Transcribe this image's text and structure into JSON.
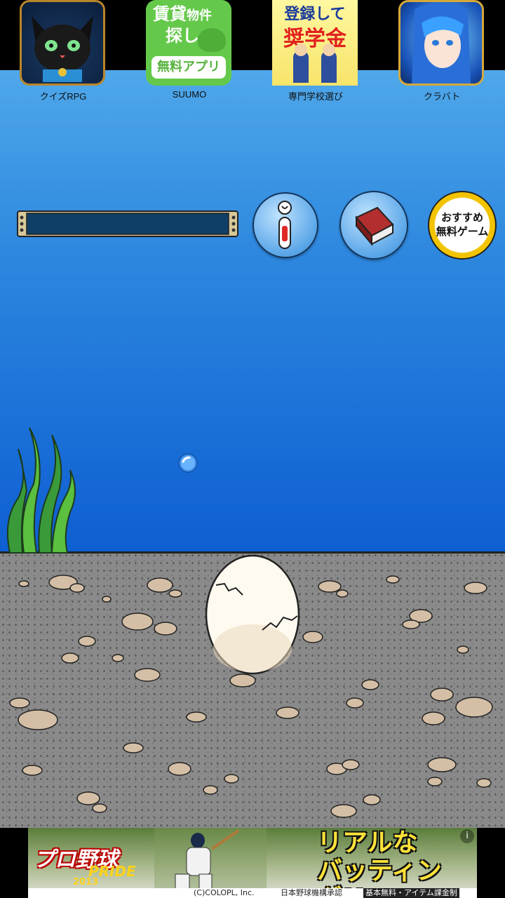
{
  "ads_top": [
    {
      "label": "クイズRPG",
      "icon": "black-cat-icon"
    },
    {
      "label": "SUUMO",
      "icon": "suumo-icon",
      "icon_text": [
        "賃貸",
        "物件",
        "探し",
        "無料アプリ"
      ]
    },
    {
      "label": "専門学校選び",
      "icon": "scholarship-icon",
      "icon_text": [
        "登録して",
        "奨学金"
      ]
    },
    {
      "label": "クラバト",
      "icon": "anime-girl-icon"
    }
  ],
  "controls": {
    "info_button_icon": "thermometer-icon",
    "book_button_icon": "book-icon",
    "recommend_label_line1": "おすすめ",
    "recommend_label_line2": "無料ゲーム"
  },
  "scene": {
    "egg_state": "cracked",
    "colors": {
      "water_top": "#4fa8ea",
      "water_bottom": "#0e5fd2",
      "seabed": "#8a8a8a"
    }
  },
  "ad_banner": {
    "logo": "プロ野球",
    "logo_sub": "PRIDE",
    "year": "2013",
    "headline_line1": "リアルな",
    "headline_line2": "バッティング!!",
    "credit_left": "(C)COLOPL, Inc.",
    "credit_mid": "日本野球機構承認",
    "credit_right": "基本無料・アイテム課金制",
    "info_icon": "i"
  }
}
